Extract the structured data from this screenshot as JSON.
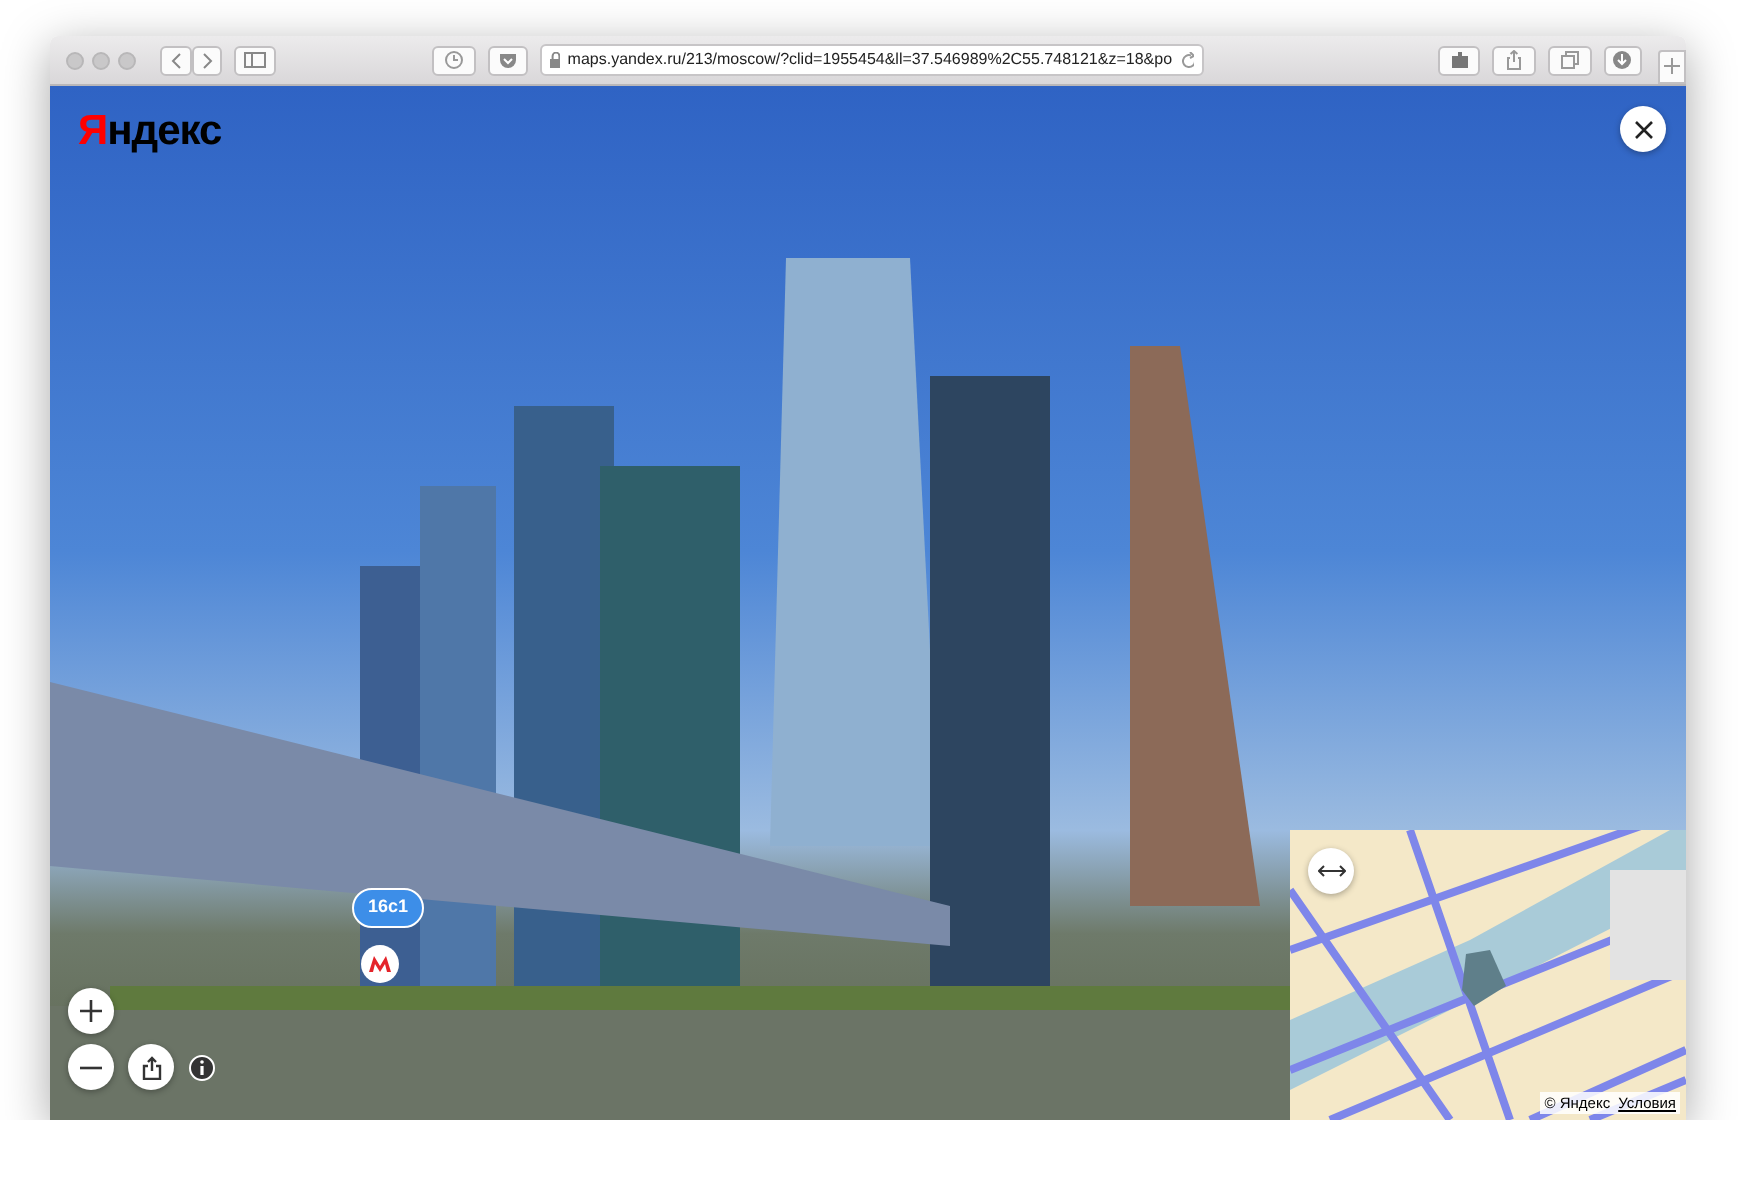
{
  "browser": {
    "address": "maps.yandex.ru/213/moscow/?clid=1955454&ll=37.546989%2C55.748121&z=18&po"
  },
  "panorama": {
    "logo": "Яндекс",
    "place_labels": [
      {
        "text": "16с1"
      }
    ]
  },
  "mini_map": {
    "copyright": "© Яндекс",
    "terms_link": "Условия"
  }
}
